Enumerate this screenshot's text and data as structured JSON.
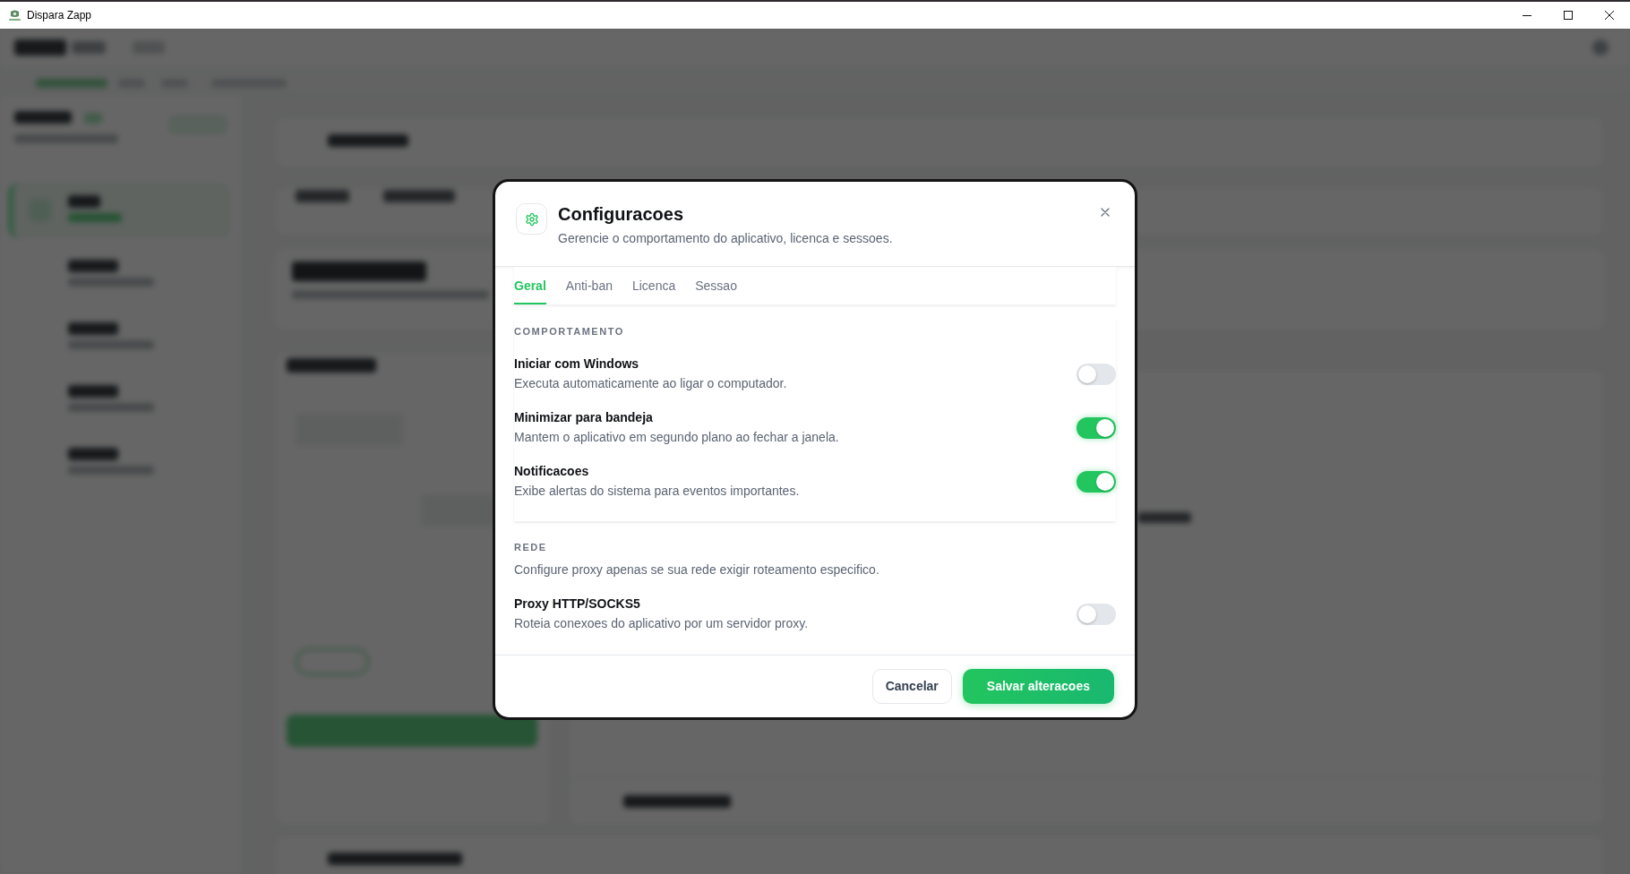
{
  "window": {
    "title": "Dispara Zapp"
  },
  "dialog": {
    "title": "Configuracoes",
    "subtitle": "Gerencie o comportamento do aplicativo, licenca e sessoes.",
    "tabs": [
      {
        "label": "Geral",
        "selected": true
      },
      {
        "label": "Anti-ban",
        "selected": false
      },
      {
        "label": "Licenca",
        "selected": false
      },
      {
        "label": "Sessao",
        "selected": false
      }
    ],
    "sections": [
      {
        "kind": "card",
        "heading": "COMPORTAMENTO",
        "settings": [
          {
            "title": "Iniciar com Windows",
            "description": "Executa automaticamente ao ligar o computador.",
            "on": false
          },
          {
            "title": "Minimizar para bandeja",
            "description": "Mantem o aplicativo em segundo plano ao fechar a janela.",
            "on": true
          },
          {
            "title": "Notificacoes",
            "description": "Exibe alertas do sistema para eventos importantes.",
            "on": true
          }
        ]
      },
      {
        "kind": "plain",
        "heading": "REDE",
        "description": "Configure proxy apenas se sua rede exigir roteamento especifico.",
        "settings": [
          {
            "title": "Proxy HTTP/SOCKS5",
            "description": "Roteia conexoes do aplicativo por um servidor proxy.",
            "on": false
          }
        ]
      }
    ],
    "buttons": [
      {
        "label": "Cancelar",
        "kind": "secondary"
      },
      {
        "label": "Salvar alteracoes",
        "kind": "primary"
      }
    ]
  }
}
